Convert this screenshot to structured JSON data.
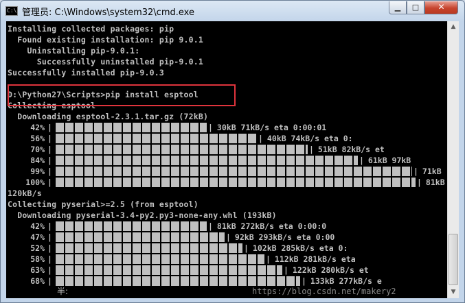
{
  "window": {
    "title": "管理员: C:\\Windows\\system32\\cmd.exe",
    "icon": "cmd-icon",
    "icon_text": "C:\\",
    "buttons": {
      "minimize": "▁",
      "maximize": "□",
      "close": "✕"
    }
  },
  "console": {
    "lines": [
      "Installing collected packages: pip",
      "  Found existing installation: pip 9.0.1",
      "    Uninstalling pip-9.0.1:",
      "      Successfully uninstalled pip-9.0.1",
      "Successfully installed pip-9.0.3",
      "",
      "D:\\Python27\\Scripts>pip install esptool",
      "Collecting esptool",
      "  Downloading esptool-2.3.1.tar.gz (72kB)",
      "120kB/s",
      "Collecting pyserial>=2.5 (from esptool)",
      "  Downloading pyserial-3.4-py2.py3-none-any.whl (193kB)"
    ],
    "progress_group_1": [
      {
        "pct": "42%",
        "fill": 0.42,
        "stats": " 30kB 71kB/s eta 0:00:01"
      },
      {
        "pct": "56%",
        "fill": 0.56,
        "stats": " 40kB 74kB/s eta 0:"
      },
      {
        "pct": "70%",
        "fill": 0.7,
        "stats": " 51kB 82kB/s et"
      },
      {
        "pct": "84%",
        "fill": 0.84,
        "stats": " 61kB 97kB"
      },
      {
        "pct": "99%",
        "fill": 0.99,
        "stats": " 71kB"
      },
      {
        "pct": "100%",
        "fill": 1.0,
        "stats": " 81kB"
      }
    ],
    "progress_group_2": [
      {
        "pct": "42%",
        "fill": 0.42,
        "stats": " 81kB 272kB/s eta 0:00:0"
      },
      {
        "pct": "47%",
        "fill": 0.47,
        "stats": " 92kB 293kB/s eta 0:00"
      },
      {
        "pct": "52%",
        "fill": 0.52,
        "stats": " 102kB 285kB/s eta 0:"
      },
      {
        "pct": "58%",
        "fill": 0.58,
        "stats": " 112kB 281kB/s eta"
      },
      {
        "pct": "63%",
        "fill": 0.63,
        "stats": " 122kB 280kB/s et"
      },
      {
        "pct": "68%",
        "fill": 0.68,
        "stats": " 133kB 277kB/s e"
      }
    ],
    "ime_status": "半:",
    "watermark": "https://blog.csdn.net/makery2"
  },
  "colors": {
    "console_bg": "#000000",
    "console_text": "#c0c0c0",
    "highlight_border": "#e0343c"
  }
}
